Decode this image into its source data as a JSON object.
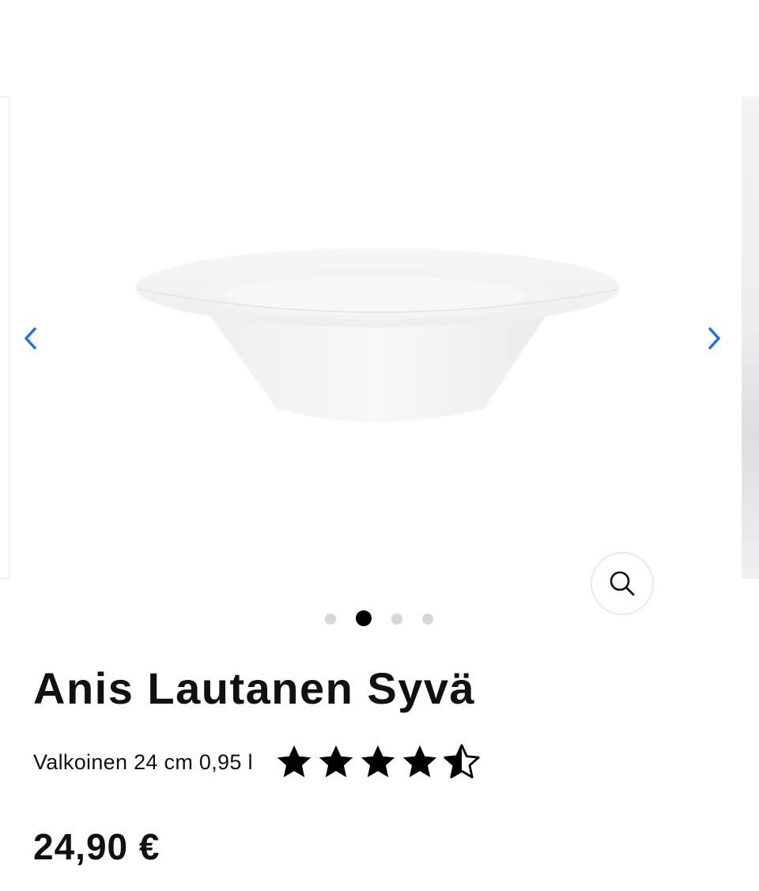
{
  "product": {
    "title": "Anis Lautanen Syvä",
    "variant": "Valkoinen 24 cm 0,95 l",
    "rating": 4.5,
    "rating_max": 5,
    "price": "24,90 €"
  },
  "gallery": {
    "total_images": 4,
    "active_index": 2,
    "prev_icon": "chevron-left-icon",
    "next_icon": "chevron-right-icon",
    "zoom_icon": "magnifier-icon"
  },
  "colors": {
    "accent": "#1a73e8",
    "text": "#111111",
    "dot_inactive": "#d6d6d6",
    "dot_active": "#000000"
  }
}
